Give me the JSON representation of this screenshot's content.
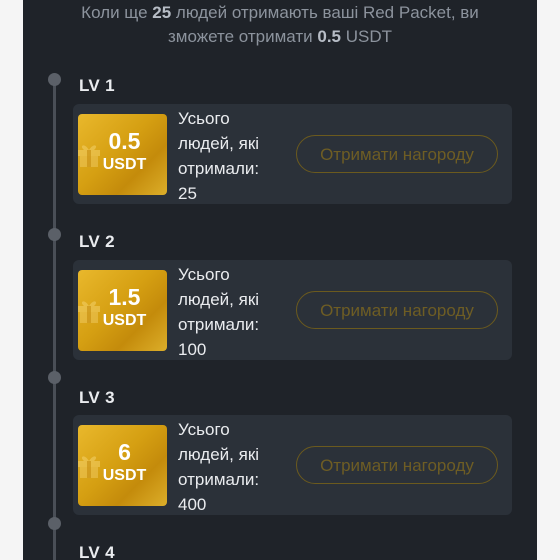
{
  "intro": {
    "line1_before": "Коли ще ",
    "people_needed": "25",
    "line1_after": " людей отримають ваші Red Packet, ви",
    "line2_before": "зможете отримати ",
    "reward_amount": "0.5",
    "line2_after": " USDT"
  },
  "levels": [
    {
      "label": "LV 1",
      "amount": "0.5",
      "unit": "USDT",
      "desc_line1": "Усього",
      "desc_line2": "людей, які",
      "desc_line3": "отримали:",
      "desc_count": "25",
      "button": "Отримати нагороду"
    },
    {
      "label": "LV 2",
      "amount": "1.5",
      "unit": "USDT",
      "desc_line1": "Усього",
      "desc_line2": "людей, які",
      "desc_line3": "отримали:",
      "desc_count": "100",
      "button": "Отримати нагороду"
    },
    {
      "label": "LV 3",
      "amount": "6",
      "unit": "USDT",
      "desc_line1": "Усього",
      "desc_line2": "людей, які",
      "desc_line3": "отримали:",
      "desc_count": "400",
      "button": "Отримати нагороду"
    },
    {
      "label": "LV 4"
    }
  ],
  "colors": {
    "panel_bg": "#1f2329",
    "card_bg": "#2b3139",
    "gold": "#d8a51a",
    "disabled_button_text": "#6e5d24"
  },
  "icons": {
    "coin": "gift-icon"
  }
}
